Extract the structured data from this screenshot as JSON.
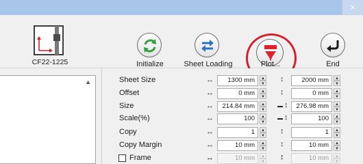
{
  "window": {
    "close_glyph": "×"
  },
  "device": {
    "name": "CF22-1225",
    "icon": "cutting-plotter-icon"
  },
  "toolbar": {
    "initialize_label": "Initialize",
    "sheet_loading_label": "Sheet Loading",
    "plot_label": "Plot...",
    "end_label": "End"
  },
  "colors": {
    "accent_green": "#2e9e3c",
    "accent_blue": "#2a72c7",
    "accent_red": "#e0222c",
    "highlight_red": "#d4202a"
  },
  "settings": {
    "sheet_size": {
      "label": "Sheet Size",
      "width": "1300 mm",
      "height": "2000 mm"
    },
    "offset": {
      "label": "Offset",
      "width": "0 mm",
      "height": "0 mm"
    },
    "size": {
      "label": "Size",
      "width": "214.84 mm",
      "height": "276.98 mm"
    },
    "scale": {
      "label": "Scale(%)",
      "width": "100",
      "height": "100"
    },
    "copy": {
      "label": "Copy",
      "width": "1",
      "height": "1"
    },
    "copy_margin": {
      "label": "Copy Margin",
      "width": "10 mm",
      "height": "10 mm"
    },
    "frame": {
      "label": "Frame",
      "checked": false,
      "width": "10 mm",
      "height": "10 mm"
    }
  },
  "glyphs": {
    "horizontal_arrow": "↔",
    "vertical_arrow": "↕",
    "spin_up": "▲",
    "spin_down": "▼",
    "scroll_up": "▲"
  }
}
